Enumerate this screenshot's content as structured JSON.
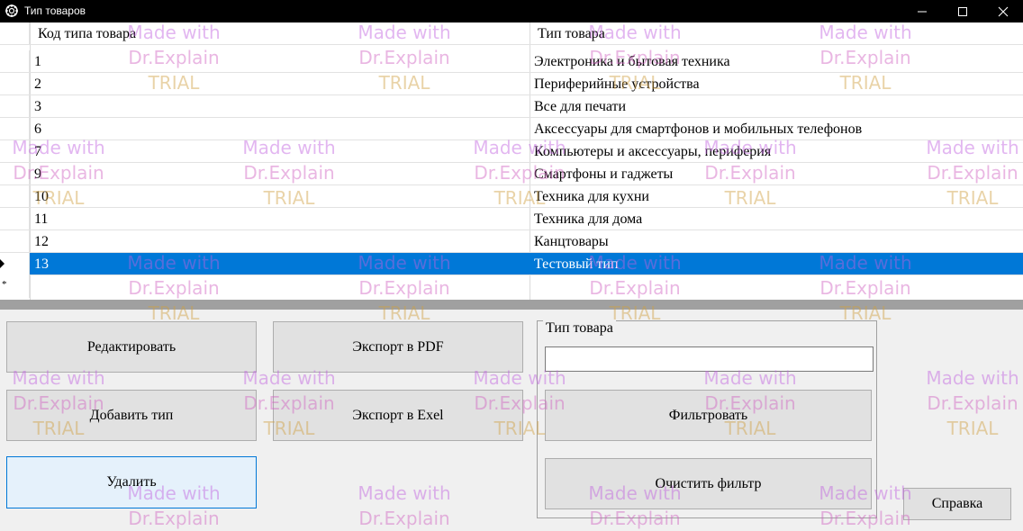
{
  "window": {
    "title": "Тип товаров",
    "icon": "app-gear-icon",
    "controls": [
      "minimize-icon",
      "maximize-icon",
      "close-icon"
    ]
  },
  "grid": {
    "columns": [
      "Код типа товара",
      "Тип товара"
    ],
    "rows": [
      {
        "code": "1",
        "type": "Электроника и бытовая техника"
      },
      {
        "code": "2",
        "type": "Периферийные устройства"
      },
      {
        "code": "3",
        "type": "Все для печати"
      },
      {
        "code": "6",
        "type": "Аксессуары для смартфонов и мобильных телефонов"
      },
      {
        "code": "7",
        "type": "Компьютеры и аксессуары, периферия"
      },
      {
        "code": "9",
        "type": "Смартфоны и гаджеты"
      },
      {
        "code": "10",
        "type": "Техника для кухни"
      },
      {
        "code": "11",
        "type": "Техника для дома"
      },
      {
        "code": "12",
        "type": "Канцтовары"
      },
      {
        "code": "13",
        "type": "Тестовый тип"
      }
    ],
    "selected_row_index": 9,
    "new_row_marker": "*",
    "selection_color": "#0078d7"
  },
  "buttons": {
    "edit": "Редактировать",
    "add": "Добавить тип",
    "delete": "Удалить",
    "export_pdf": "Экспорт в PDF",
    "export_excel": "Экспорт в Exel",
    "filter": "Фильтровать",
    "clear_filter": "Очистить фильтр",
    "help": "Справка"
  },
  "filter": {
    "group_label": "Тип товара",
    "value": ""
  },
  "watermark": {
    "line1": "Made with",
    "line2": "Dr.Explain",
    "line3": "TRIAL"
  }
}
